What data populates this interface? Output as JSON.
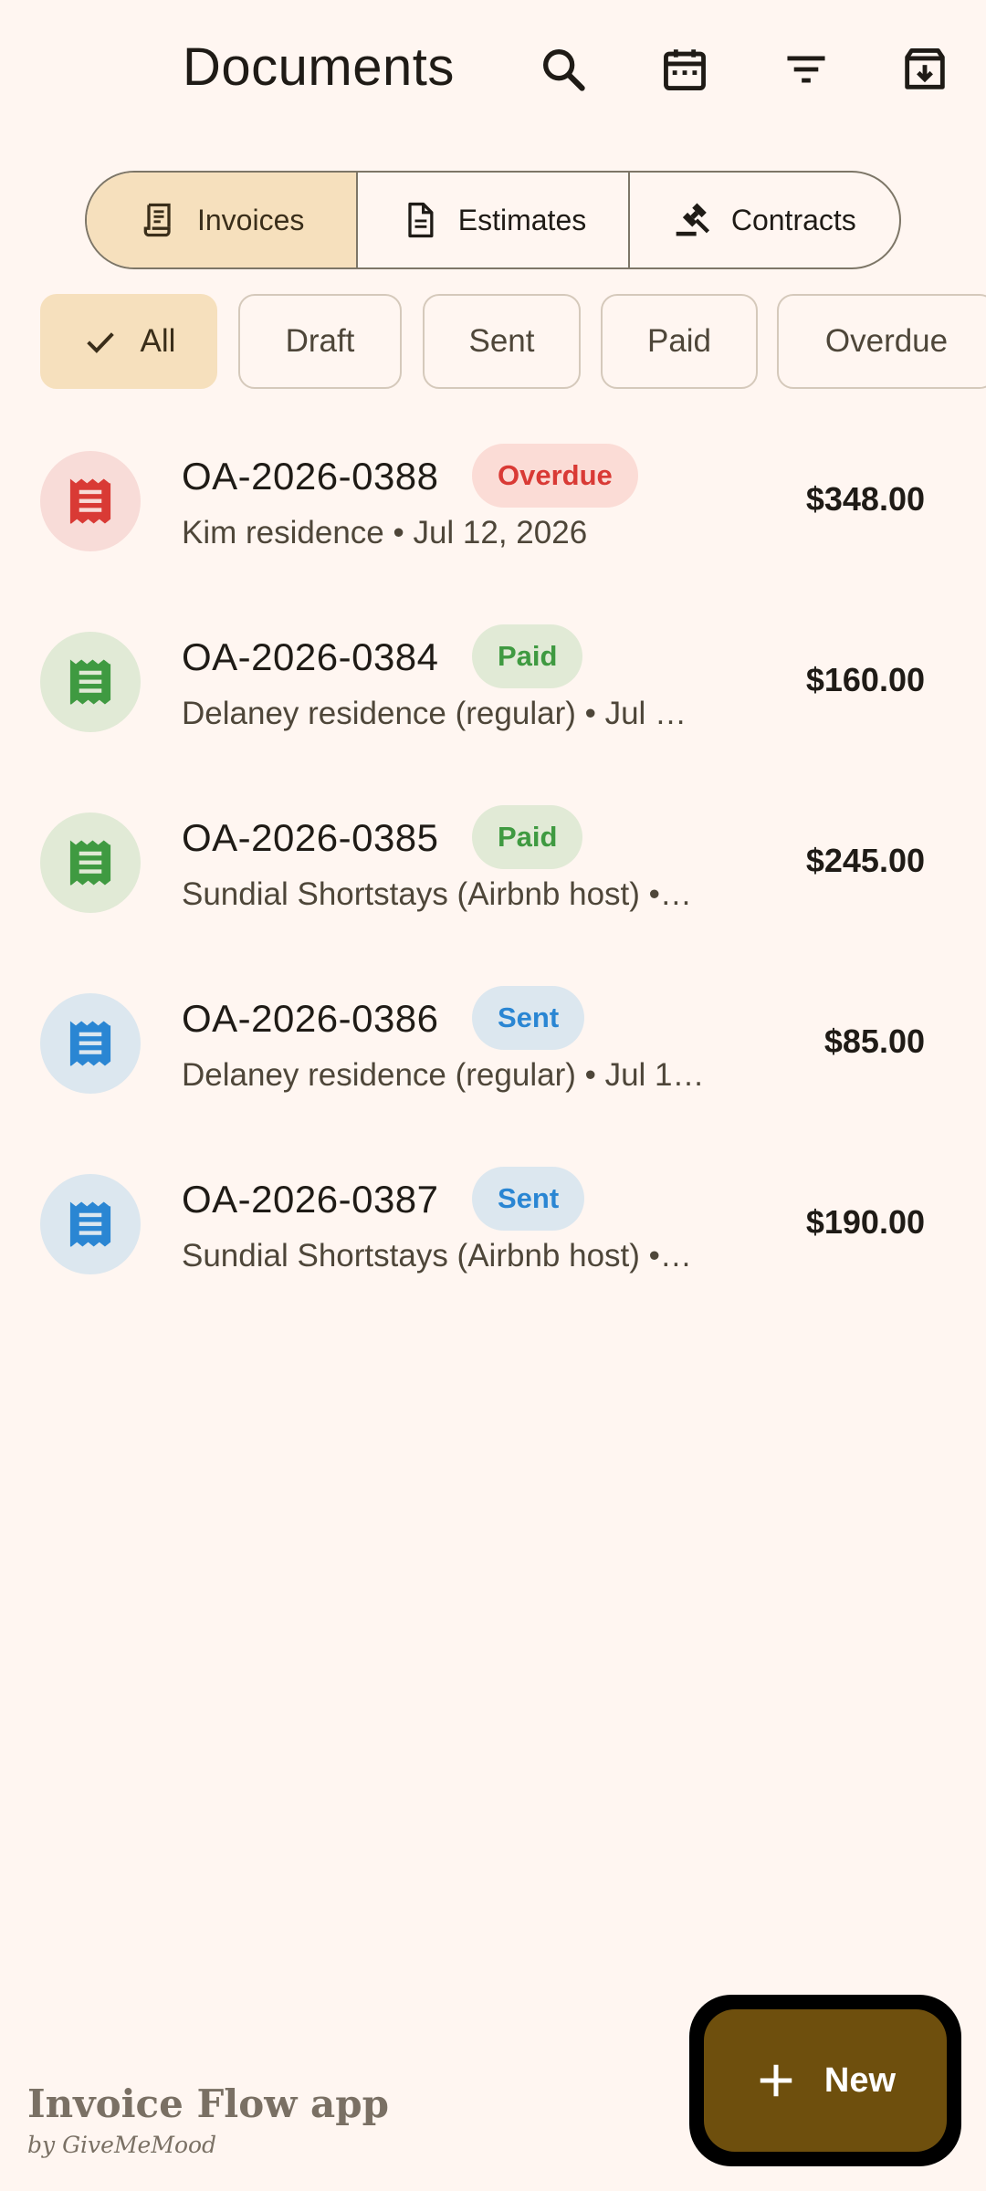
{
  "header": {
    "title": "Documents",
    "icons": [
      "search-icon",
      "calendar-icon",
      "filter-icon",
      "archive-icon"
    ]
  },
  "segments": [
    {
      "label": "Invoices",
      "icon": "receipt-icon",
      "selected": true
    },
    {
      "label": "Estimates",
      "icon": "document-icon",
      "selected": false
    },
    {
      "label": "Contracts",
      "icon": "gavel-icon",
      "selected": false
    }
  ],
  "filters": [
    {
      "label": "All",
      "selected": true
    },
    {
      "label": "Draft",
      "selected": false
    },
    {
      "label": "Sent",
      "selected": false
    },
    {
      "label": "Paid",
      "selected": false
    },
    {
      "label": "Overdue",
      "selected": false
    }
  ],
  "invoices": [
    {
      "number": "OA-2026-0388",
      "status": "Overdue",
      "subtitle": "Kim residence • Jul 12, 2026",
      "amount": "$348.00"
    },
    {
      "number": "OA-2026-0384",
      "status": "Paid",
      "subtitle": "Delaney residence (regular) • Jul …",
      "amount": "$160.00"
    },
    {
      "number": "OA-2026-0385",
      "status": "Paid",
      "subtitle": "Sundial Shortstays (Airbnb host) •…",
      "amount": "$245.00"
    },
    {
      "number": "OA-2026-0386",
      "status": "Sent",
      "subtitle": "Delaney residence (regular) • Jul 1…",
      "amount": "$85.00"
    },
    {
      "number": "OA-2026-0387",
      "status": "Sent",
      "subtitle": "Sundial Shortstays (Airbnb host) •…",
      "amount": "$190.00"
    }
  ],
  "status_colors": {
    "Overdue": {
      "text": "#d93a35",
      "badge_bg": "#fbdcd6",
      "avatar_bg": "#f8dcd8",
      "icon": "#d93a35"
    },
    "Paid": {
      "text": "#3f9a41",
      "badge_bg": "#e1ead6",
      "avatar_bg": "#e1ead6",
      "icon": "#3f9a41"
    },
    "Sent": {
      "text": "#2a86d3",
      "badge_bg": "#dce7ef",
      "avatar_bg": "#dce7ef",
      "icon": "#2a86d3"
    }
  },
  "fab": {
    "label": "New",
    "icon": "plus-icon"
  },
  "branding": {
    "name": "Invoice Flow app",
    "by": "by GiveMeMood"
  }
}
